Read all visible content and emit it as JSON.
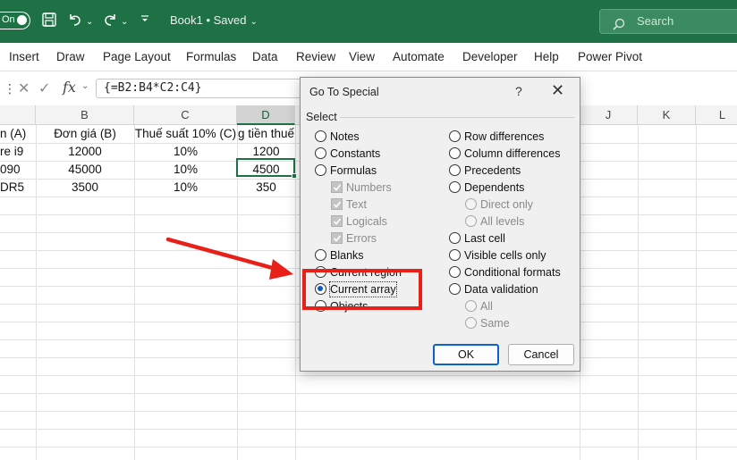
{
  "titlebar": {
    "autosave_label": "On",
    "doc_title": "Book1 • Saved",
    "search_placeholder": "Search"
  },
  "ribbon": {
    "tabs": [
      "Insert",
      "Draw",
      "Page Layout",
      "Formulas",
      "Data",
      "Review",
      "View",
      "Automate",
      "Developer",
      "Help",
      "Power Pivot"
    ]
  },
  "formula_bar": {
    "formula": "{=B2:B4*C2:C4}"
  },
  "grid": {
    "columns": [
      "B",
      "C",
      "D",
      "J",
      "K",
      "L"
    ],
    "selected_column": "D",
    "rows": [
      [
        "n (A)",
        "Đơn giá (B)",
        "Thuế suất 10% (C)",
        "g tiền thuế ("
      ],
      [
        "re i9",
        "12000",
        "10%",
        "1200"
      ],
      [
        "090",
        "45000",
        "10%",
        "4500"
      ],
      [
        "DR5",
        "3500",
        "10%",
        "350"
      ]
    ]
  },
  "dialog": {
    "title": "Go To Special",
    "help": "?",
    "section_label": "Select",
    "left_options": {
      "notes": "Notes",
      "constants": "Constants",
      "formulas": "Formulas",
      "formula_types": [
        "Numbers",
        "Text",
        "Logicals",
        "Errors"
      ],
      "blanks": "Blanks",
      "current_region": "Current region",
      "current_array": "Current array",
      "objects": "Objects"
    },
    "right_options": {
      "row_differences": "Row differences",
      "column_differences": "Column differences",
      "precedents": "Precedents",
      "dependents": "Dependents",
      "direct_only": "Direct only",
      "all_levels": "All levels",
      "last_cell": "Last cell",
      "visible_cells_only": "Visible cells only",
      "conditional_formats": "Conditional formats",
      "data_validation": "Data validation",
      "all": "All",
      "same": "Same"
    },
    "selected_option": "Current array",
    "ok_label": "OK",
    "cancel_label": "Cancel"
  },
  "colors": {
    "excel_green": "#1e7145",
    "annotation_red": "#e8201a",
    "radio_selected": "#0a5bbd"
  }
}
